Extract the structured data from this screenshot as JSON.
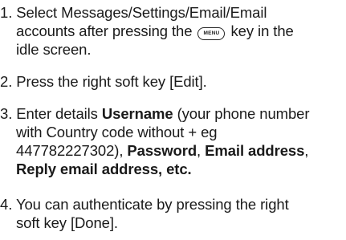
{
  "steps": [
    {
      "number": "1.",
      "l1": "Select Messages/Settings/Email/Email",
      "l2a": "accounts after pressing the",
      "key_label": "MENU",
      "l2b": "key in the",
      "l3": "idle screen."
    },
    {
      "number": "2.",
      "l1": "Press the right soft key [Edit]."
    },
    {
      "number": "3.",
      "l1a": "Enter details",
      "l1b": "Username",
      "l1c": "(your phone number",
      "l2": "with Country code without + eg",
      "l3a": "447782227302),",
      "l3b": "Password",
      "l3c": ",",
      "l3d": "Email address",
      "l3e": ",",
      "l4": "Reply email address, etc."
    },
    {
      "number": "4.",
      "l1": "You can authenticate by pressing the right",
      "l2": "soft key [Done]."
    }
  ]
}
